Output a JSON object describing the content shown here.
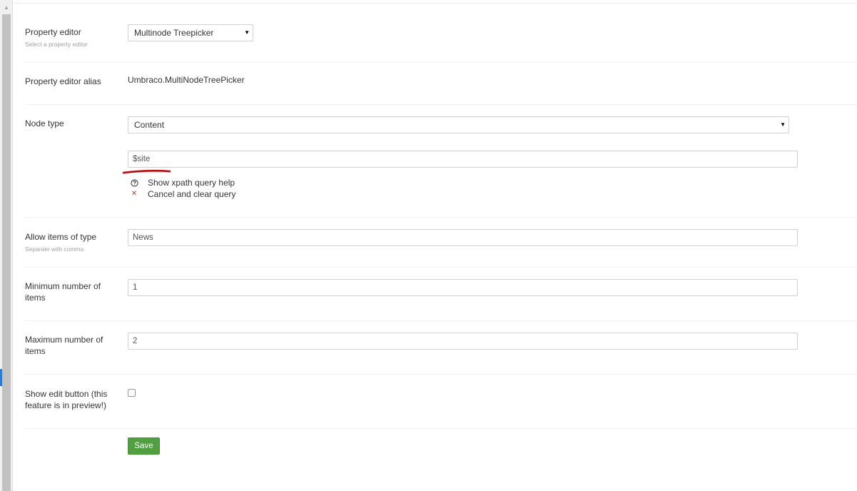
{
  "form": {
    "property_editor": {
      "label": "Property editor",
      "description": "Select a property editor",
      "selected": "Multinode Treepicker"
    },
    "alias": {
      "label": "Property editor alias",
      "value": "Umbraco.MultiNodeTreePicker"
    },
    "node_type": {
      "label": "Node type",
      "selected": "Content",
      "query_value": "$site",
      "help_link": "Show xpath query help",
      "cancel_link": "Cancel and clear query"
    },
    "allow_items": {
      "label": "Allow items of type",
      "description": "Separate with comma",
      "value": "News"
    },
    "min_items": {
      "label": "Minimum number of items",
      "value": "1"
    },
    "max_items": {
      "label": "Maximum number of items",
      "value": "2"
    },
    "show_edit": {
      "label": "Show edit button (this feature is in preview!)",
      "checked": false
    },
    "save_label": "Save"
  },
  "icons": {
    "help": "question-circle-icon",
    "cancel": "close-icon",
    "dropdown": "caret-down-icon"
  },
  "colors": {
    "save_button": "#4fa03f",
    "cancel_icon": "#c0392b",
    "annotation": "#cc0000"
  }
}
